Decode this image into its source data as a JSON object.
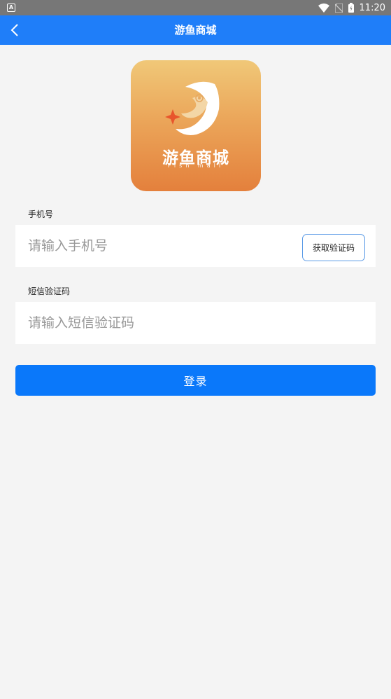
{
  "status_bar": {
    "time": "11:20",
    "left_icon": "A"
  },
  "app_bar": {
    "title": "游鱼商城"
  },
  "logo": {
    "brand": "游鱼商城",
    "sub": "Fish mall"
  },
  "form": {
    "phone_label": "手机号",
    "phone_placeholder": "请输入手机号",
    "phone_value": "",
    "get_code_label": "获取验证码",
    "sms_label": "短信验证码",
    "sms_placeholder": "请输入短信验证码",
    "sms_value": "",
    "login_label": "登录"
  },
  "colors": {
    "primary": "#1f7ef9",
    "logo_top": "#f0c878",
    "logo_bottom": "#e4803c",
    "status_bar": "#777777"
  }
}
